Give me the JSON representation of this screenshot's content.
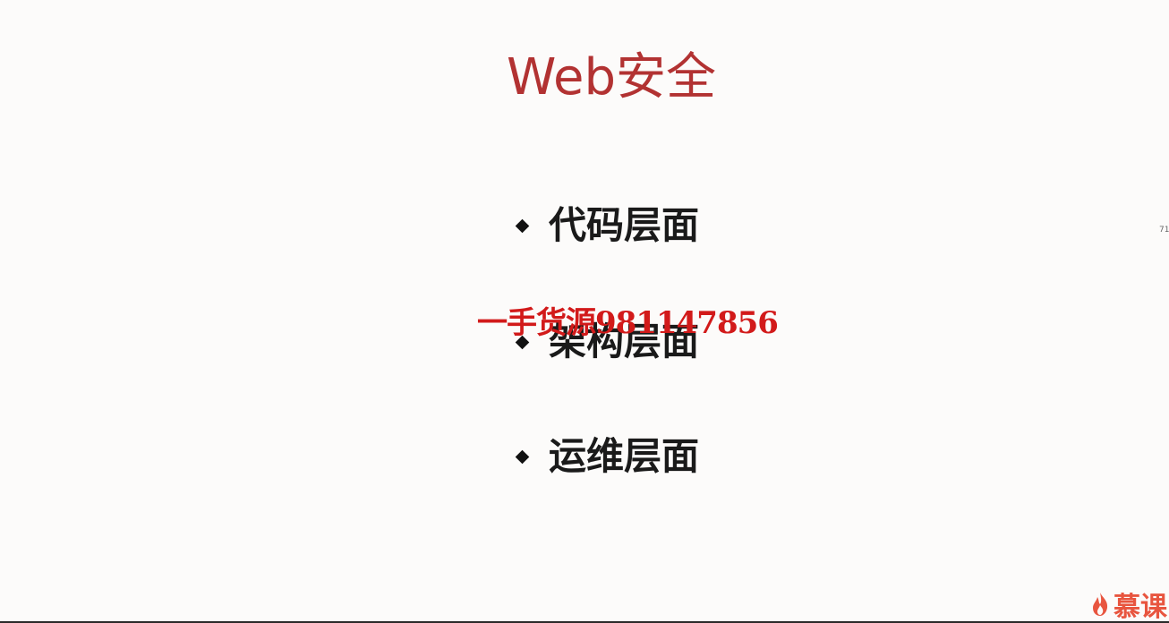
{
  "slide": {
    "title": "Web安全",
    "bullets": [
      "代码层面",
      "架构层面",
      "运维层面"
    ]
  },
  "overlay": {
    "watermark": "一手货源981147856",
    "side_number": "71"
  },
  "logo": {
    "text": "慕课",
    "icon": "flame-icon"
  },
  "colors": {
    "title": "#b23232",
    "watermark": "#d21a1a",
    "logo": "#e8553f",
    "background": "#fcfbfa"
  }
}
